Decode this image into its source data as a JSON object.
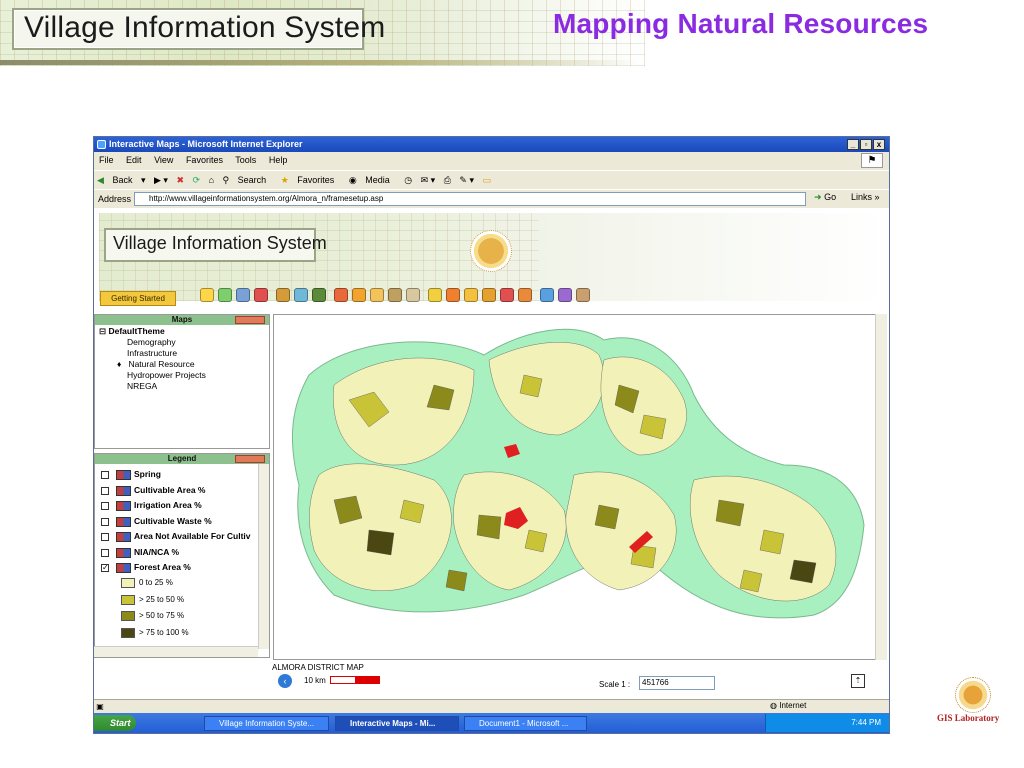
{
  "slide": {
    "header_title": "Village Information System",
    "title": "Mapping Natural Resources",
    "footer_label": "GIS Laboratory"
  },
  "browser": {
    "window_title": "Interactive Maps - Microsoft Internet Explorer",
    "menu": [
      "File",
      "Edit",
      "View",
      "Favorites",
      "Tools",
      "Help"
    ],
    "toolbar": [
      "Back",
      "Search",
      "Favorites",
      "Media"
    ],
    "address_label": "Address",
    "address": "http://www.villageinformationsystem.org/Almora_n/framesetup.asp",
    "go_label": "Go",
    "links_label": "Links",
    "status_zone": "Internet"
  },
  "app": {
    "banner_title": "Village Information System",
    "getting_started": "Getting Started",
    "maps_panel": {
      "title": "Maps",
      "theme": "DefaultTheme",
      "items": [
        "Demography",
        "Infrastructure",
        "Natural Resource",
        "Hydropower Projects",
        "NREGA"
      ],
      "selected": "Natural Resource"
    },
    "legend_panel": {
      "title": "Legend",
      "layers": [
        {
          "label": "Spring",
          "checked": false
        },
        {
          "label": "Cultivable Area %",
          "checked": false
        },
        {
          "label": "Irrigation Area %",
          "checked": false
        },
        {
          "label": "Cultivable Waste %",
          "checked": false
        },
        {
          "label": "Area Not Available For Cultiv",
          "checked": false
        },
        {
          "label": "NIA/NCA %",
          "checked": false
        },
        {
          "label": "Forest Area %",
          "checked": true
        }
      ],
      "classes": [
        {
          "label": "0 to 25 %",
          "color": "#f2f2b8"
        },
        {
          "label": "> 25 to 50 %",
          "color": "#c9c437"
        },
        {
          "label": "> 50 to 75 %",
          "color": "#8c8a1a"
        },
        {
          "label": "> 75 to 100 %",
          "color": "#4a4712"
        }
      ]
    },
    "map": {
      "caption": "ALMORA DISTRICT MAP",
      "scalebar_label": "10 km",
      "scale_label": "Scale 1 :",
      "scale_value": "451766",
      "background_color": "#a8f0c0",
      "highlight_color": "#e02020"
    }
  },
  "taskbar": {
    "start": "Start",
    "tasks": [
      "Village Information Syste...",
      "Interactive Maps - Mi...",
      "Document1 - Microsoft ..."
    ],
    "clock": "7:44 PM"
  }
}
